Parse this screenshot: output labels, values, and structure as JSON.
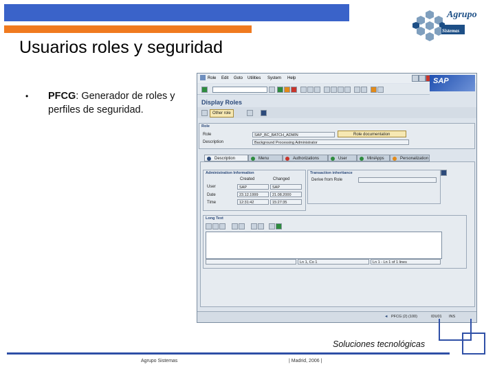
{
  "slide": {
    "title": "Usuarios roles y seguridad",
    "bullet_bold": "PFCG",
    "bullet_rest": ": Generador de roles y perfiles de seguridad.",
    "tagline": "Soluciones tecnológicas",
    "footer_company": "Agrupo Sistemas",
    "footer_place": "| Madrid, 2006 |"
  },
  "logo": {
    "name": "Agrupo",
    "sub": "Sistemas"
  },
  "sap": {
    "menu": [
      "Role",
      "Edit",
      "Goto",
      "Utilities",
      "System",
      "Help"
    ],
    "brand": "SAP",
    "screen_title": "Display Roles",
    "other_role_label": "Other role",
    "role_frame_title": "Role",
    "role_label": "Role",
    "role_value": "SAP_BC_BATCH_ADMIN",
    "role_doc_label": "Role documentation",
    "description_label": "Description",
    "description_value": "Background Processing Administrator",
    "tabs": [
      "Description",
      "Menu",
      "Authorizations",
      "User",
      "MiniApps",
      "Personalization"
    ],
    "admin_frame_title": "Administration Information",
    "created_label": "Created",
    "changed_label": "Changed",
    "user_label": "User",
    "date_label": "Date",
    "time_label": "Time",
    "created_user": "SAP",
    "created_date": "23.12.1999",
    "created_time": "12:31:42",
    "changed_user": "SAP",
    "changed_date": "21.08.2000",
    "changed_time": "15:27:35",
    "transaction_frame_title": "Transaction inheritance",
    "derive_label": "Derive from Role",
    "longtext_frame_title": "Long Text",
    "line_info": "Ln 1, Co 1",
    "lines_info": "Ln 1 - Ln 1 of 1 lines",
    "status_program": "PFCG (2) (100)",
    "status_server": "IDU01",
    "status_mode": "INS"
  },
  "colors": {
    "accent_blue": "#3a63c9",
    "accent_orange": "#f07a1f",
    "footer_blue": "#2e4fa6"
  }
}
